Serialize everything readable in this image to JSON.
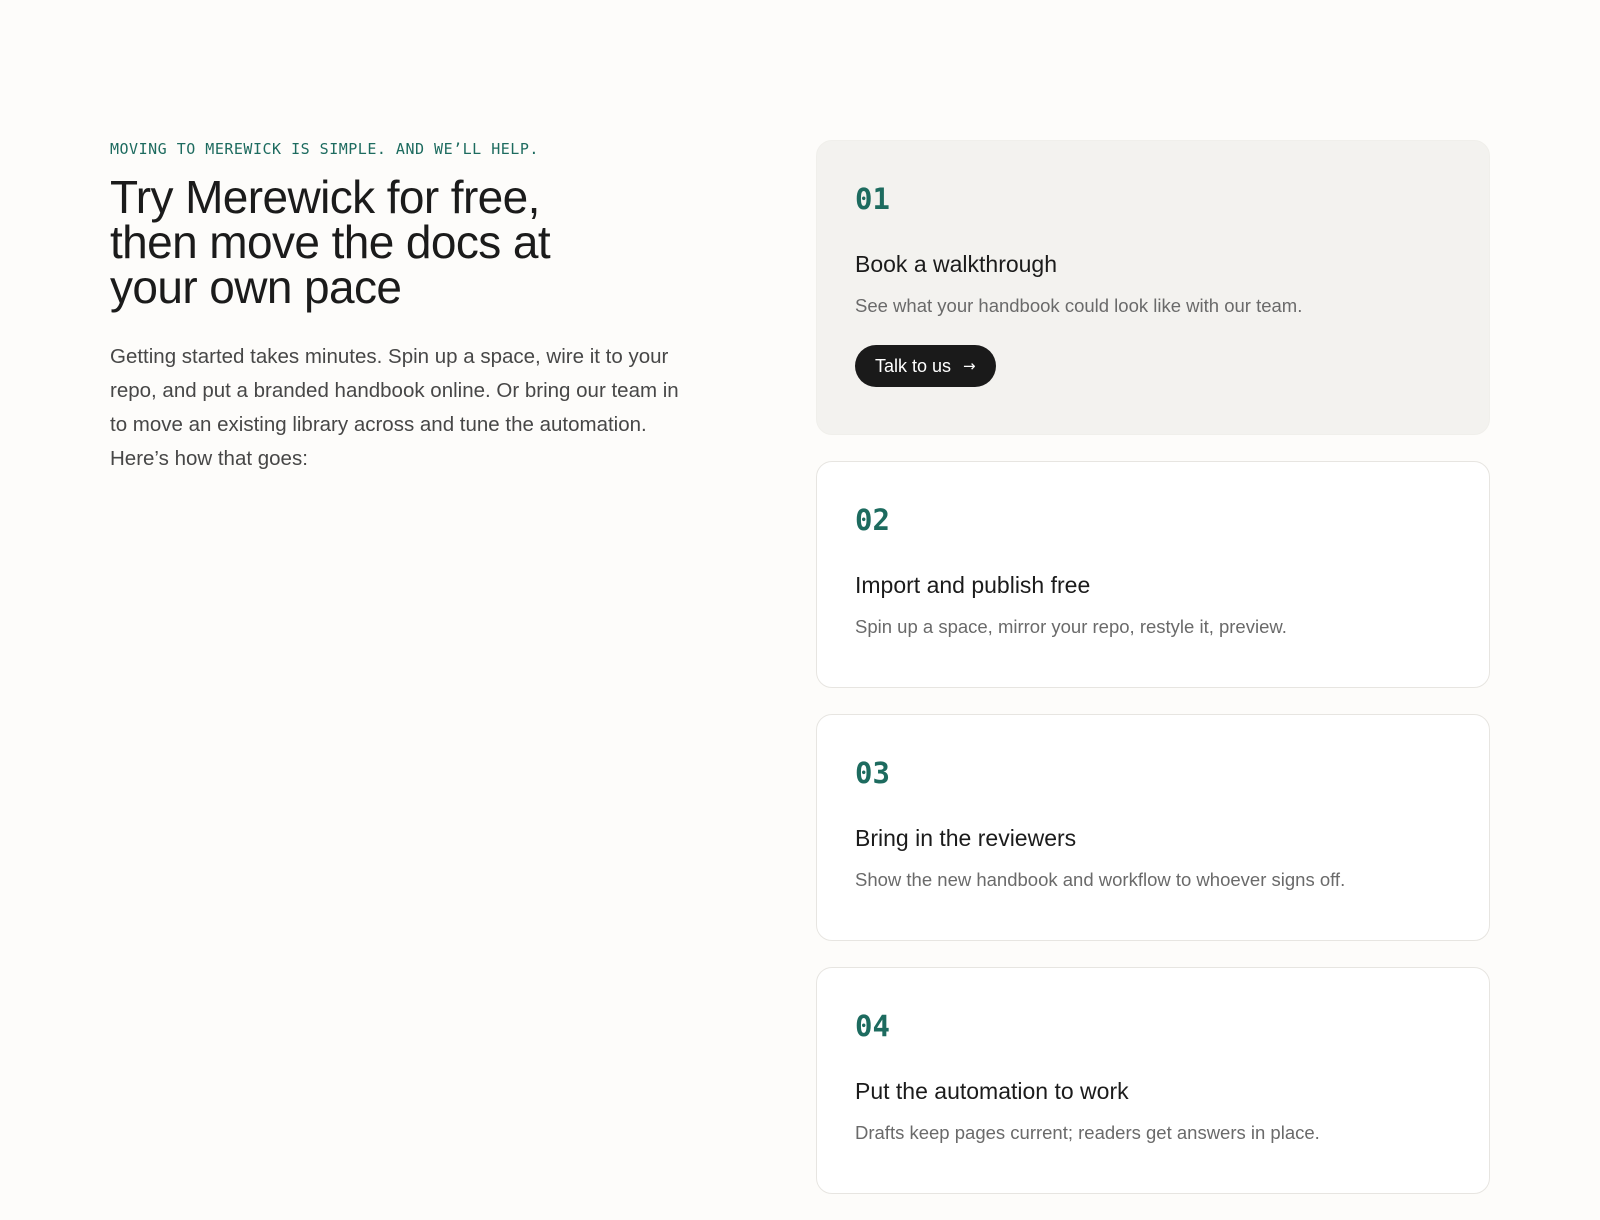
{
  "hero": {
    "eyebrow": "MOVING TO MEREWICK IS SIMPLE. AND WE’LL HELP.",
    "headline": "Try Merewick for free, then move the docs at your own pace",
    "intro": "Getting started takes minutes. Spin up a space, wire it to your repo, and put a branded handbook online. Or bring our team in to move an existing library across and tune the automation. Here’s how that goes:"
  },
  "steps": [
    {
      "number": "01",
      "title": "Book a walkthrough",
      "description": "See what your handbook could look like with our team.",
      "cta_label": "Talk to us",
      "cta_icon": "arrow-right-icon"
    },
    {
      "number": "02",
      "title": "Import and publish free",
      "description": "Spin up a space, mirror your repo, restyle it, preview."
    },
    {
      "number": "03",
      "title": "Bring in the reviewers",
      "description": "Show the new handbook and workflow to whoever signs off."
    },
    {
      "number": "04",
      "title": "Put the automation to work",
      "description": "Drafts keep pages current; readers get answers in place."
    }
  ],
  "colors": {
    "accent": "#1d6b5f",
    "background": "#fdfcfa",
    "featured_card": "#f3f2ef",
    "button": "#1a1a1a"
  }
}
